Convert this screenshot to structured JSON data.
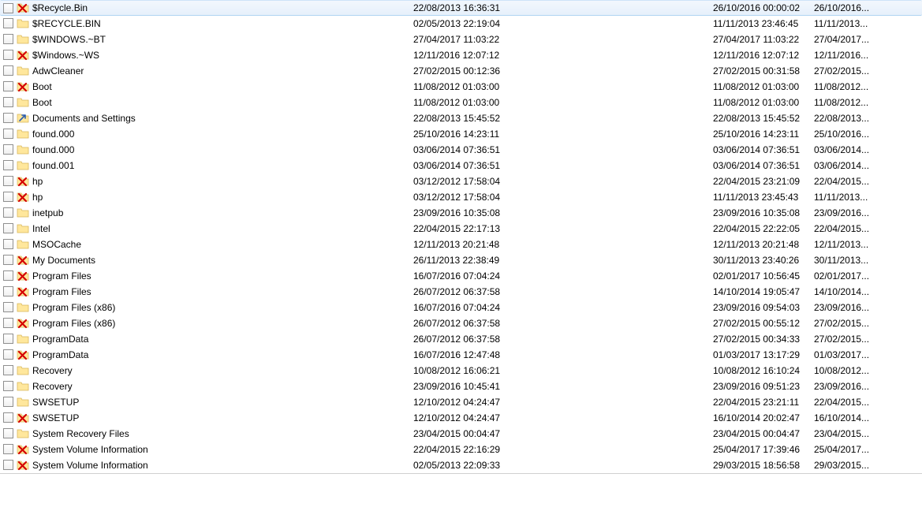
{
  "rows": [
    {
      "selected": true,
      "icon": "x",
      "name": "$Recycle.Bin",
      "d1": "22/08/2013 16:36:31",
      "d2": "26/10/2016 00:00:02",
      "d3": "26/10/2016..."
    },
    {
      "selected": false,
      "icon": "folder",
      "name": "$RECYCLE.BIN",
      "d1": "02/05/2013 22:19:04",
      "d2": "11/11/2013 23:46:45",
      "d3": "11/11/2013..."
    },
    {
      "selected": false,
      "icon": "folder",
      "name": "$WINDOWS.~BT",
      "d1": "27/04/2017 11:03:22",
      "d2": "27/04/2017 11:03:22",
      "d3": "27/04/2017..."
    },
    {
      "selected": false,
      "icon": "x",
      "name": "$Windows.~WS",
      "d1": "12/11/2016 12:07:12",
      "d2": "12/11/2016 12:07:12",
      "d3": "12/11/2016..."
    },
    {
      "selected": false,
      "icon": "folder",
      "name": "AdwCleaner",
      "d1": "27/02/2015 00:12:36",
      "d2": "27/02/2015 00:31:58",
      "d3": "27/02/2015..."
    },
    {
      "selected": false,
      "icon": "x",
      "name": "Boot",
      "d1": "11/08/2012 01:03:00",
      "d2": "11/08/2012 01:03:00",
      "d3": "11/08/2012..."
    },
    {
      "selected": false,
      "icon": "folder",
      "name": "Boot",
      "d1": "11/08/2012 01:03:00",
      "d2": "11/08/2012 01:03:00",
      "d3": "11/08/2012..."
    },
    {
      "selected": false,
      "icon": "link",
      "name": "Documents and Settings",
      "d1": "22/08/2013 15:45:52",
      "d2": "22/08/2013 15:45:52",
      "d3": "22/08/2013..."
    },
    {
      "selected": false,
      "icon": "folder",
      "name": "found.000",
      "d1": "25/10/2016 14:23:11",
      "d2": "25/10/2016 14:23:11",
      "d3": "25/10/2016..."
    },
    {
      "selected": false,
      "icon": "folder",
      "name": "found.000",
      "d1": "03/06/2014 07:36:51",
      "d2": "03/06/2014 07:36:51",
      "d3": "03/06/2014..."
    },
    {
      "selected": false,
      "icon": "folder",
      "name": "found.001",
      "d1": "03/06/2014 07:36:51",
      "d2": "03/06/2014 07:36:51",
      "d3": "03/06/2014..."
    },
    {
      "selected": false,
      "icon": "x",
      "name": "hp",
      "d1": "03/12/2012 17:58:04",
      "d2": "22/04/2015 23:21:09",
      "d3": "22/04/2015..."
    },
    {
      "selected": false,
      "icon": "x",
      "name": "hp",
      "d1": "03/12/2012 17:58:04",
      "d2": "11/11/2013 23:45:43",
      "d3": "11/11/2013..."
    },
    {
      "selected": false,
      "icon": "folder",
      "name": "inetpub",
      "d1": "23/09/2016 10:35:08",
      "d2": "23/09/2016 10:35:08",
      "d3": "23/09/2016..."
    },
    {
      "selected": false,
      "icon": "folder",
      "name": "Intel",
      "d1": "22/04/2015 22:17:13",
      "d2": "22/04/2015 22:22:05",
      "d3": "22/04/2015..."
    },
    {
      "selected": false,
      "icon": "folder",
      "name": "MSOCache",
      "d1": "12/11/2013 20:21:48",
      "d2": "12/11/2013 20:21:48",
      "d3": "12/11/2013..."
    },
    {
      "selected": false,
      "icon": "x",
      "name": "My Documents",
      "d1": "26/11/2013 22:38:49",
      "d2": "30/11/2013 23:40:26",
      "d3": "30/11/2013..."
    },
    {
      "selected": false,
      "icon": "x",
      "name": "Program Files",
      "d1": "16/07/2016 07:04:24",
      "d2": "02/01/2017 10:56:45",
      "d3": "02/01/2017..."
    },
    {
      "selected": false,
      "icon": "x",
      "name": "Program Files",
      "d1": "26/07/2012 06:37:58",
      "d2": "14/10/2014 19:05:47",
      "d3": "14/10/2014..."
    },
    {
      "selected": false,
      "icon": "folder",
      "name": "Program Files (x86)",
      "d1": "16/07/2016 07:04:24",
      "d2": "23/09/2016 09:54:03",
      "d3": "23/09/2016..."
    },
    {
      "selected": false,
      "icon": "x",
      "name": "Program Files (x86)",
      "d1": "26/07/2012 06:37:58",
      "d2": "27/02/2015 00:55:12",
      "d3": "27/02/2015..."
    },
    {
      "selected": false,
      "icon": "folder",
      "name": "ProgramData",
      "d1": "26/07/2012 06:37:58",
      "d2": "27/02/2015 00:34:33",
      "d3": "27/02/2015..."
    },
    {
      "selected": false,
      "icon": "x",
      "name": "ProgramData",
      "d1": "16/07/2016 12:47:48",
      "d2": "01/03/2017 13:17:29",
      "d3": "01/03/2017..."
    },
    {
      "selected": false,
      "icon": "folder",
      "name": "Recovery",
      "d1": "10/08/2012 16:06:21",
      "d2": "10/08/2012 16:10:24",
      "d3": "10/08/2012..."
    },
    {
      "selected": false,
      "icon": "folder",
      "name": "Recovery",
      "d1": "23/09/2016 10:45:41",
      "d2": "23/09/2016 09:51:23",
      "d3": "23/09/2016..."
    },
    {
      "selected": false,
      "icon": "folder",
      "name": "SWSETUP",
      "d1": "12/10/2012 04:24:47",
      "d2": "22/04/2015 23:21:11",
      "d3": "22/04/2015..."
    },
    {
      "selected": false,
      "icon": "x",
      "name": "SWSETUP",
      "d1": "12/10/2012 04:24:47",
      "d2": "16/10/2014 20:02:47",
      "d3": "16/10/2014..."
    },
    {
      "selected": false,
      "icon": "folder",
      "name": "System Recovery Files",
      "d1": "23/04/2015 00:04:47",
      "d2": "23/04/2015 00:04:47",
      "d3": "23/04/2015..."
    },
    {
      "selected": false,
      "icon": "x",
      "name": "System Volume Information",
      "d1": "22/04/2015 22:16:29",
      "d2": "25/04/2017 17:39:46",
      "d3": "25/04/2017..."
    },
    {
      "selected": false,
      "icon": "x",
      "name": "System Volume Information",
      "d1": "02/05/2013 22:09:33",
      "d2": "29/03/2015 18:56:58",
      "d3": "29/03/2015..."
    }
  ]
}
